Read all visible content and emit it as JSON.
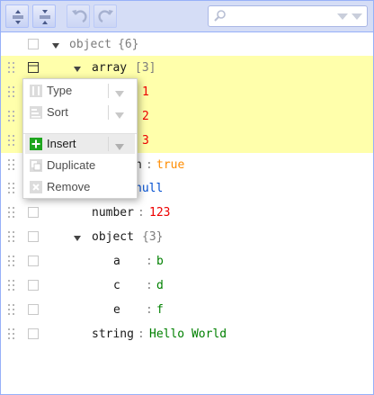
{
  "search": {
    "placeholder": "",
    "value": ""
  },
  "tree": {
    "root": {
      "key": "object",
      "count": "{6}"
    },
    "array": {
      "key": "array",
      "count": "[3]",
      "items": [
        "1",
        "2",
        "3"
      ]
    },
    "boolean": {
      "key_visible": "n",
      "value": "true"
    },
    "null": {
      "value": "null"
    },
    "number": {
      "key": "number",
      "value": "123"
    },
    "object": {
      "key": "object",
      "count": "{3}"
    },
    "obj_a": {
      "key": "a",
      "value": "b"
    },
    "obj_c": {
      "key": "c",
      "value": "d"
    },
    "obj_e": {
      "key": "e",
      "value": "f"
    },
    "string": {
      "key": "string",
      "value": "Hello World"
    },
    "separator": ":"
  },
  "context_menu": {
    "type_label": "Type",
    "sort_label": "Sort",
    "insert_label": "Insert",
    "duplicate_label": "Duplicate",
    "remove_label": "Remove"
  },
  "colors": {
    "highlight": "#ffffab",
    "string": "#008000",
    "number": "#ee0000",
    "boolean": "#ff8c00",
    "null": "#004ed0",
    "menubar": "#d5ddf6",
    "insert_icon": "#1ea51e"
  },
  "icons": {
    "expand_all": "expand-all-icon",
    "collapse_all": "collapse-all-icon",
    "undo": "undo-icon",
    "redo": "redo-icon",
    "search": "search-icon",
    "search_next": "chevron-down-icon",
    "drag": "drag-handle-icon",
    "context": "context-menu-icon",
    "expand": "expand-triangle-icon"
  }
}
